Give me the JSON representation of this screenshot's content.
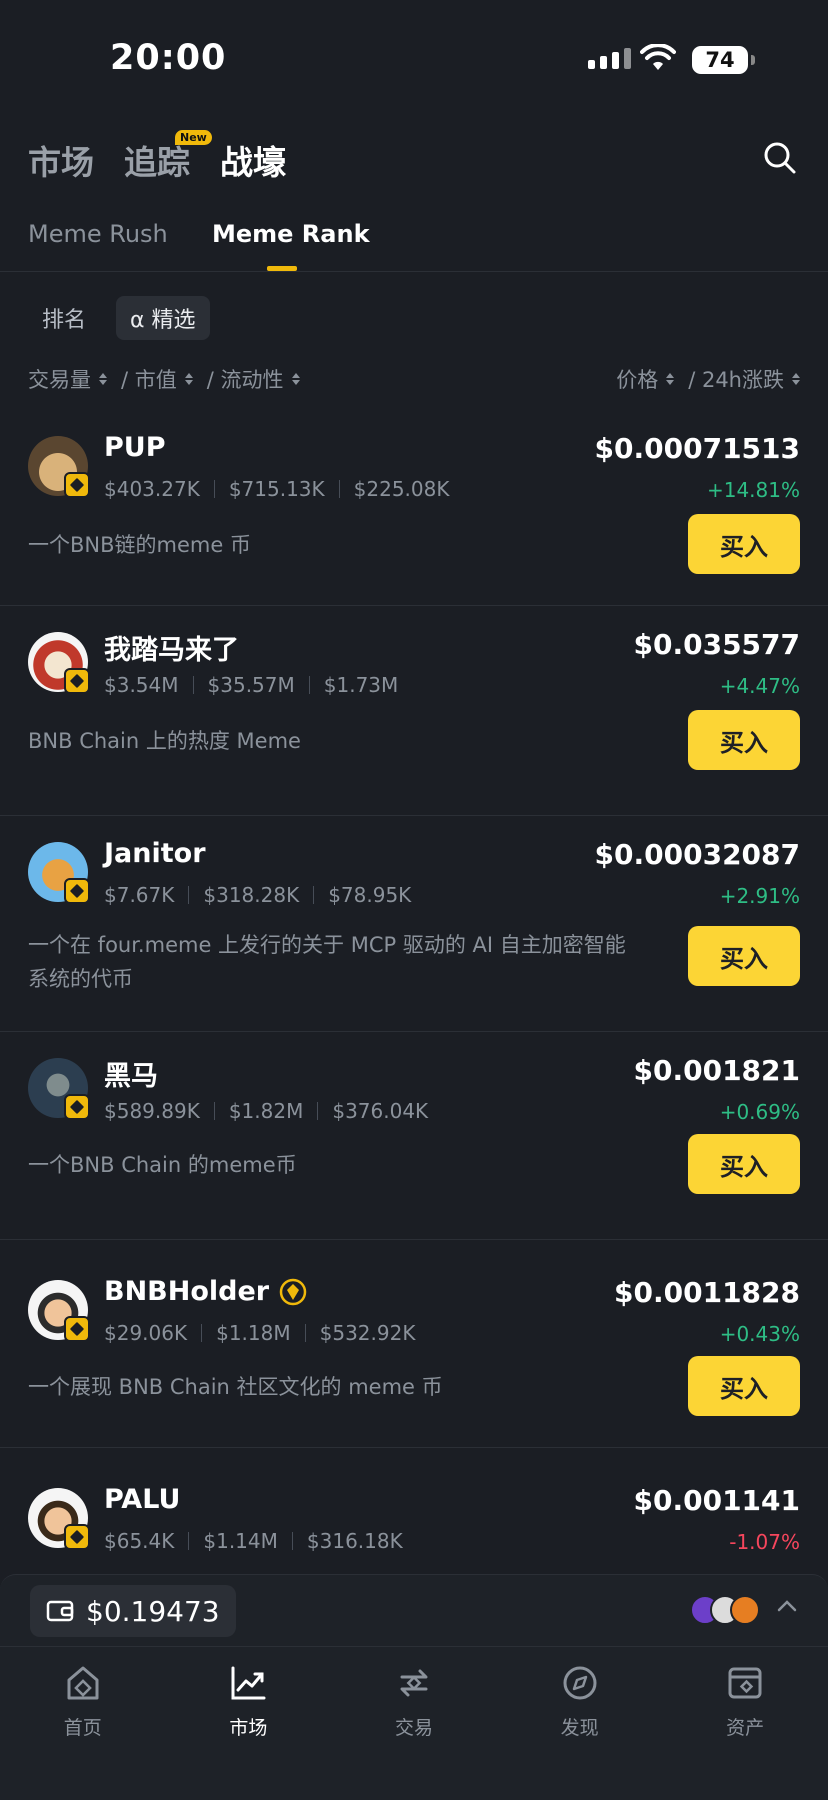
{
  "status": {
    "time": "20:00",
    "battery": "74"
  },
  "header": {
    "tabs": [
      {
        "label": "市场",
        "active": false
      },
      {
        "label": "追踪",
        "active": false,
        "badge": "New"
      },
      {
        "label": "战壕",
        "active": true
      }
    ],
    "search_icon": "search-icon"
  },
  "subtabs": [
    {
      "label": "Meme Rush",
      "active": false
    },
    {
      "label": "Meme Rank",
      "active": true
    }
  ],
  "filters": [
    {
      "label": "排名",
      "active": false
    },
    {
      "label": "α 精选",
      "active": true
    }
  ],
  "sort": {
    "left": [
      "交易量",
      "/ 市值",
      "/ 流动性"
    ],
    "right": [
      "价格",
      "/ 24h涨跌"
    ]
  },
  "buy_label": "买入",
  "tokens": [
    {
      "name": "PUP",
      "volume": "$403.27K",
      "mcap": "$715.13K",
      "liquidity": "$225.08K",
      "price": "$0.00071513",
      "change": "+14.81%",
      "direction": "up",
      "desc": "一个BNB链的meme 币",
      "avatar_color": "#8a6a3c",
      "verified": false
    },
    {
      "name": "我踏马来了",
      "volume": "$3.54M",
      "mcap": "$35.57M",
      "liquidity": "$1.73M",
      "price": "$0.035577",
      "change": "+4.47%",
      "direction": "up",
      "desc": "BNB Chain 上的热度 Meme",
      "avatar_color": "#c0392b",
      "verified": false
    },
    {
      "name": "Janitor",
      "volume": "$7.67K",
      "mcap": "$318.28K",
      "liquidity": "$78.95K",
      "price": "$0.00032087",
      "change": "+2.91%",
      "direction": "up",
      "desc": "一个在 four.meme 上发行的关于 MCP 驱动的 AI 自主加密智能系统的代币",
      "avatar_color": "#4aa3df",
      "verified": false
    },
    {
      "name": "黑马",
      "volume": "$589.89K",
      "mcap": "$1.82M",
      "liquidity": "$376.04K",
      "price": "$0.001821",
      "change": "+0.69%",
      "direction": "up",
      "desc": "一个BNB Chain 的meme币",
      "avatar_color": "#34495e",
      "verified": false
    },
    {
      "name": "BNBHolder",
      "volume": "$29.06K",
      "mcap": "$1.18M",
      "liquidity": "$532.92K",
      "price": "$0.0011828",
      "change": "+0.43%",
      "direction": "up",
      "desc": "一个展现 BNB Chain 社区文化的 meme 币",
      "avatar_color": "#e8e8e8",
      "verified": true
    },
    {
      "name": "PALU",
      "volume": "$65.4K",
      "mcap": "$1.14M",
      "liquidity": "$316.18K",
      "price": "$0.001141",
      "change": "-1.07%",
      "direction": "down",
      "desc": "",
      "avatar_color": "#f1f1f1",
      "verified": false
    }
  ],
  "wallet": {
    "balance": "$0.19473"
  },
  "nav": [
    {
      "label": "首页",
      "icon": "home-icon",
      "active": false
    },
    {
      "label": "市场",
      "icon": "market-chart-icon",
      "active": true
    },
    {
      "label": "交易",
      "icon": "trade-swap-icon",
      "active": false
    },
    {
      "label": "发现",
      "icon": "discover-compass-icon",
      "active": false
    },
    {
      "label": "资产",
      "icon": "assets-wallet-icon",
      "active": false
    }
  ],
  "colors": {
    "accent": "#fcd535",
    "up": "#2ebd85",
    "down": "#f6465d",
    "background": "#1b1e24"
  }
}
